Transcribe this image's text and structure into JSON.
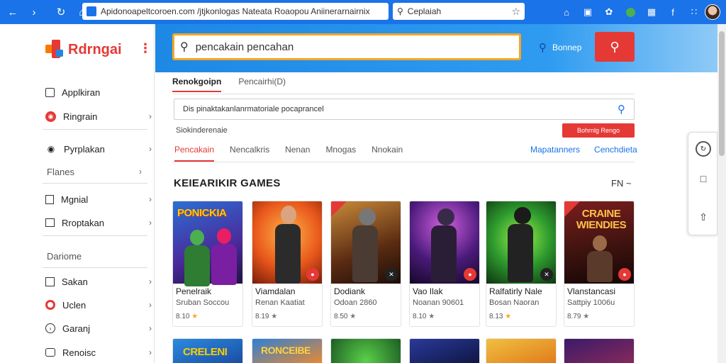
{
  "browser": {
    "url": "Apidonoapeltcoroen.com /jtjkonlogas Nateata Roaopou Aniinerarnairnix",
    "search": "Ceplaiah"
  },
  "sidebar": {
    "logo_text": "Rdrngai",
    "items_top": [
      {
        "label": "Applkiran",
        "icon": "grid-icon"
      },
      {
        "label": "Ringrain",
        "icon": "ring-icon"
      }
    ],
    "items_mid": [
      {
        "label": "Pyrplakan",
        "icon": "gamepad-icon"
      }
    ],
    "section_1": "Flanes",
    "items_mid2": [
      {
        "label": "Mgnial",
        "icon": "puzzle-icon"
      },
      {
        "label": "Rroptakan",
        "icon": "list-icon"
      }
    ],
    "section_2": "Dariome",
    "items_bottom": [
      {
        "label": "Sakan",
        "icon": "box-icon"
      },
      {
        "label": "Uclen",
        "icon": "target-icon"
      },
      {
        "label": "Garanj",
        "icon": "clock-icon"
      },
      {
        "label": "Renoisc",
        "icon": "controller-icon"
      }
    ]
  },
  "header": {
    "search_value": "pencakain pencahan",
    "link_label": "Bonnep"
  },
  "tabs1": [
    "Renokgoipn",
    "Pencairhi(D)"
  ],
  "subsearch": {
    "value": "Dis pinaktakanlanrmatoriale pocaprancel",
    "label": "Siokinderenaie",
    "button": "Bohrnlg Rengo"
  },
  "tabs2": [
    "Pencakain",
    "Nencalkris",
    "Nenan",
    "Mnogas",
    "Nnokain"
  ],
  "tabs2_right": [
    "Mapatanners",
    "Cenchdieta"
  ],
  "section": {
    "title": "KEIEARIKIR GAMES",
    "right": "FN ~"
  },
  "games": [
    {
      "art_text": "PONICKIA",
      "title": "Penelraik",
      "sub": "Sruban Soccou",
      "rating": "8.10"
    },
    {
      "art_text": "",
      "title": "Viamdalan",
      "sub": "Renan Kaatiat",
      "rating": "8.19"
    },
    {
      "art_text": "",
      "title": "Dodiank",
      "sub": "Odoan 2860",
      "rating": "8.50"
    },
    {
      "art_text": "",
      "title": "Vao Ilak",
      "sub": "Noanan 90601",
      "rating": "8.10"
    },
    {
      "art_text": "",
      "title": "Ralfatirly Nale",
      "sub": "Bosan Naoran",
      "rating": "8.13"
    },
    {
      "art_text": "CRAINE WIENDIES",
      "title": "Vlanstancasi",
      "sub": "Sattpiy 1006u",
      "rating": "8.79"
    }
  ],
  "games_row2": [
    {
      "art_text": "CRELENI"
    },
    {
      "art_text": "RONCEIBE"
    },
    {
      "art_text": ""
    },
    {
      "art_text": ""
    },
    {
      "art_text": ""
    },
    {
      "art_text": ""
    }
  ],
  "colors": {
    "brand_blue": "#1a73e8",
    "accent_red": "#e53935",
    "search_border": "#f5a623"
  }
}
